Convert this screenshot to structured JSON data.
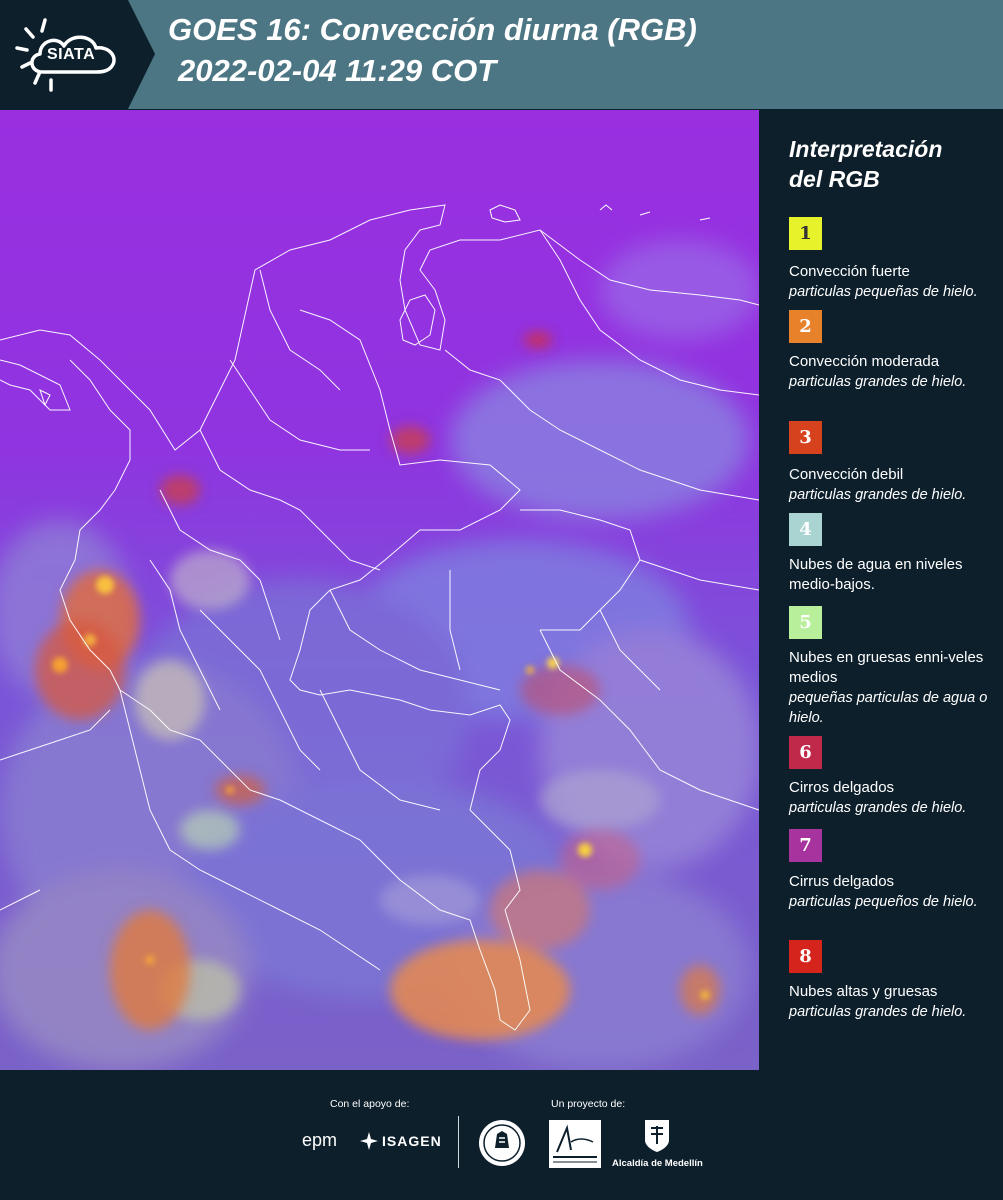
{
  "header": {
    "logo_text": "SIATA",
    "title_line1": "GOES 16: Convección diurna (RGB)",
    "title_line2": "2022-02-04 11:29 COT",
    "background_color": "#4c7683"
  },
  "legend": {
    "title_line1": "Interpretación",
    "title_line2": "del RGB",
    "items": [
      {
        "number": "1",
        "color": "#e7f22a",
        "number_color": "#333333",
        "label": "Convección fuerte",
        "sub": "particulas pequeñas de hielo."
      },
      {
        "number": "2",
        "color": "#e8822a",
        "number_color": "#ffffff",
        "label": "Convección moderada",
        "sub": "particulas grandes de hielo."
      },
      {
        "number": "3",
        "color": "#d7421e",
        "number_color": "#ffffff",
        "label": "Convección debil",
        "sub": "particulas grandes de hielo."
      },
      {
        "number": "4",
        "color": "#a9d4d2",
        "number_color": "#ffffff",
        "label": "Nubes de agua en niveles medio-bajos.",
        "sub": ""
      },
      {
        "number": "5",
        "color": "#b8ef9a",
        "number_color": "#ffffff",
        "label": "Nubes en gruesas enni-veles medios",
        "sub": "pequeñas particulas de agua o hielo."
      },
      {
        "number": "6",
        "color": "#c0294a",
        "number_color": "#ffffff",
        "label": "Cirros delgados",
        "sub": "particulas grandes de hielo."
      },
      {
        "number": "7",
        "color": "#a6339e",
        "number_color": "#ffffff",
        "label": "Cirrus delgados",
        "sub": "particulas pequeños de hielo."
      },
      {
        "number": "8",
        "color": "#d4241b",
        "number_color": "#ffffff",
        "label": "Nubes altas y gruesas",
        "sub": "particulas grandes de hielo."
      }
    ]
  },
  "footer": {
    "support_label": "Con el apoyo de:",
    "project_label": "Un proyecto de:",
    "sponsors": [
      "epm",
      "ISAGEN"
    ],
    "partners": [
      "Área METROPOLITANA Valle de Aburrá",
      "Alcaldía de Medellín"
    ]
  }
}
